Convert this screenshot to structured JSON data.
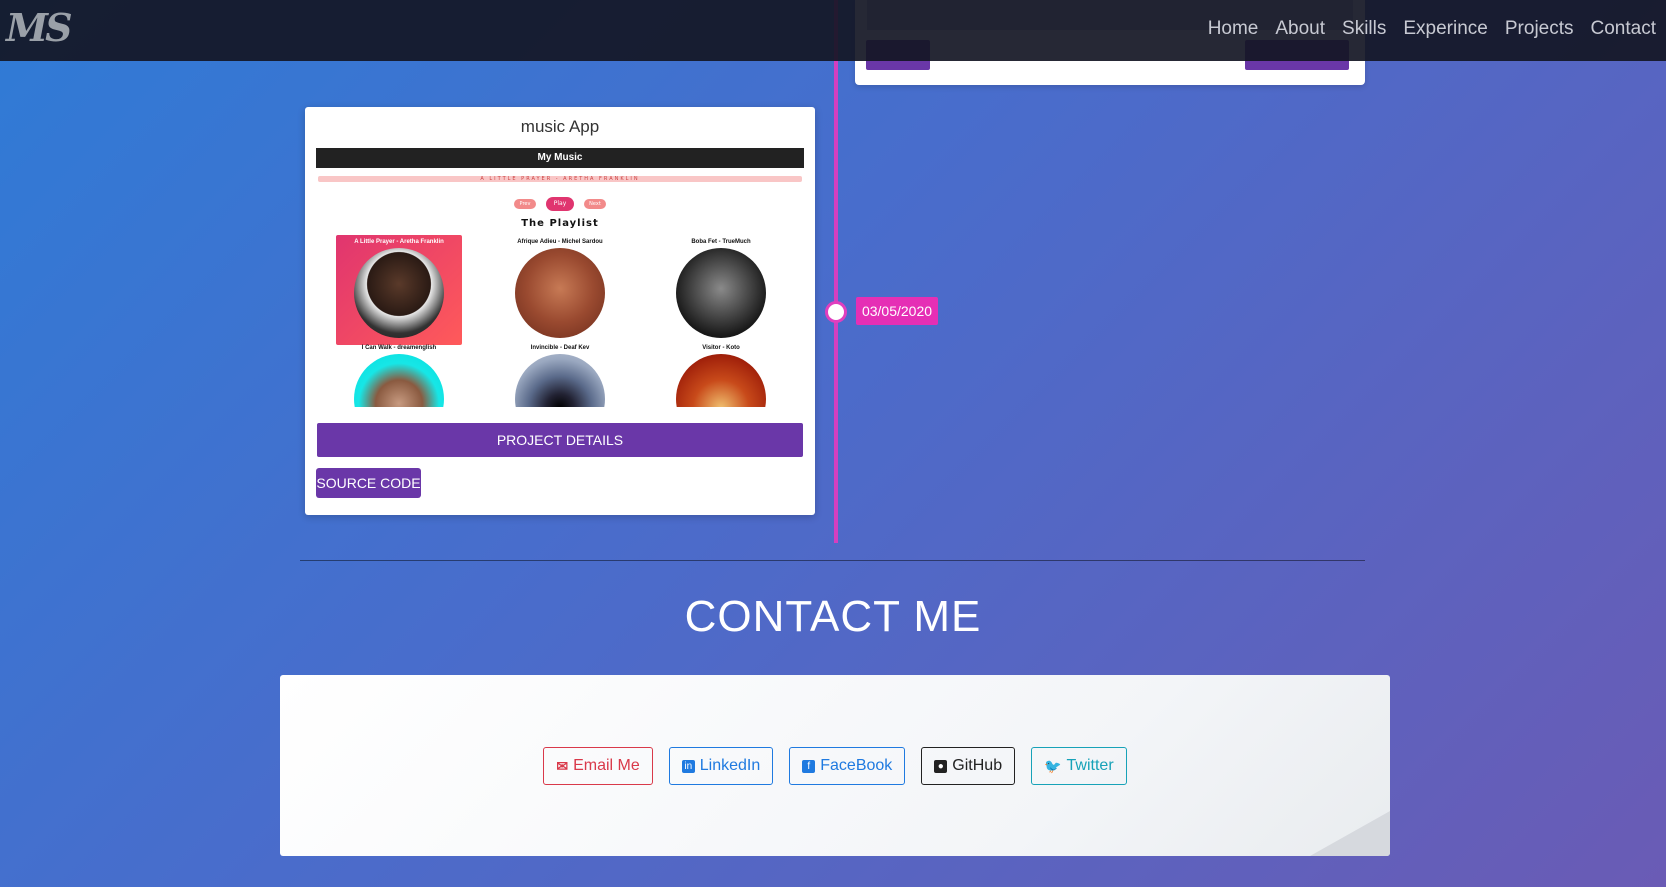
{
  "nav": {
    "logo": "MS",
    "links": [
      "Home",
      "About",
      "Skills",
      "Experince",
      "Projects",
      "Contact"
    ]
  },
  "timeline": {
    "date": "03/05/2020"
  },
  "project": {
    "title": "music App",
    "details_label": "PROJECT DETAILS",
    "source_label": "SOURCE CODE",
    "preview": {
      "header": "My Music",
      "now_playing": "A LITTLE PRAYER - ARETHA FRANKLIN",
      "prev": "Prev",
      "play": "Play",
      "next": "Next",
      "playlist_title": "The Playlist",
      "tracks": [
        "A Little Prayer - Aretha Franklin",
        "Afrique Adieu - Michel Sardou",
        "Boba Fet - TrueMuch",
        "I Can Walk - dreamenglish",
        "Invincible - Deaf Kev",
        "Visitor - Koto"
      ]
    }
  },
  "contact": {
    "title": "CONTACT ME",
    "socials": {
      "email": "Email Me",
      "linkedin": "LinkedIn",
      "facebook": "FaceBook",
      "github": "GitHub",
      "twitter": "Twitter"
    }
  },
  "colors": {
    "accent_purple": "#6a37a8",
    "timeline_pink": "#e52fb5"
  }
}
